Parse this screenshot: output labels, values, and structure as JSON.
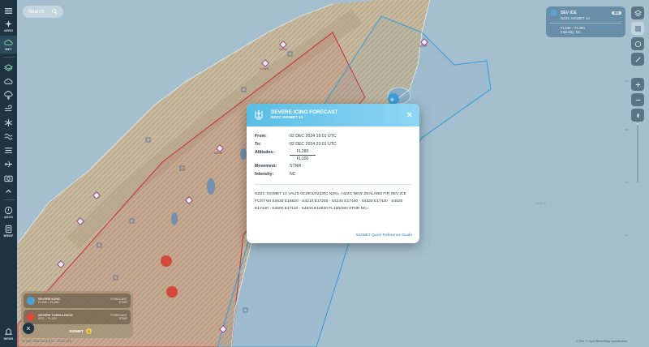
{
  "search": {
    "placeholder": "Search"
  },
  "rail": {
    "items": [
      {
        "icon": "menu-icon",
        "label": ""
      },
      {
        "icon": "aero-icon",
        "label": "AERO"
      },
      {
        "icon": "met-icon",
        "label": "MET"
      },
      {
        "icon": "layers-icon",
        "label": ""
      },
      {
        "icon": "cloud-icon",
        "label": ""
      },
      {
        "icon": "storm-icon",
        "label": ""
      },
      {
        "icon": "wind-icon",
        "label": ""
      },
      {
        "icon": "ice-icon",
        "label": ""
      },
      {
        "icon": "turbulence-icon",
        "label": ""
      },
      {
        "icon": "fog-icon",
        "label": ""
      },
      {
        "icon": "plane-icon",
        "label": ""
      },
      {
        "icon": "camera-icon",
        "label": ""
      },
      {
        "icon": "chevron-up-icon",
        "label": ""
      },
      {
        "icon": "advs-icon",
        "label": "ADVS"
      },
      {
        "icon": "brief-icon",
        "label": "BRIEF"
      }
    ],
    "bottom": {
      "icon": "notifications-icon",
      "label": "NEWS"
    }
  },
  "sig_panel": {
    "title": "SEV ICE",
    "badge": "SIG",
    "line1": "NZZC SIGMET 14",
    "line2": "FL100 – FL280",
    "line3": "Intensity: NC"
  },
  "legend": {
    "items": [
      {
        "name": "SEVERE ICING",
        "range": "FL100 – FL280",
        "type": "FORECAST",
        "movement": "STNR",
        "color": "#4aa3d8"
      },
      {
        "name": "SEVERE TURBULENCE",
        "range": "SFC – FL120",
        "type": "FORECAST",
        "movement": "STNR",
        "color": "#d84a3a"
      }
    ],
    "footer": "SIGMET",
    "footer_count": "2"
  },
  "modal": {
    "title": "SEVERE ICING FORECAST",
    "subtitle": "NZZC SIGMET 14",
    "fields": {
      "from_label": "From:",
      "from": "02 DEC 2024 19:01 UTC",
      "to_label": "To:",
      "to": "02 DEC 2024 23:01 UTC",
      "alt_label": "Altitudes:",
      "alt_top": "FL280",
      "alt_bottom": "FL100",
      "mov_label": "Movement:",
      "movement": "STNR",
      "int_label": "Intensity:",
      "intensity": "NC"
    },
    "raw": "NZZC SIGMET 14 VALID 021901/022301 NZKL- NZZC NEW ZEALAND FIR SEV ICE FCST WI S4630 E16820 - S4210 E17250 - S4240 E17440 - S4320 E17420 - S4530 E17140 - S4600 E17110 - S4630 E16820 FL100/280 STNR NC=",
    "link": "SIGMET Quick Reference Guide"
  },
  "map_labels": [
    "NZNS",
    "NZWS",
    "NZHK",
    "NZWF"
  ],
  "attribution": "© Esri © OpenStreetMap contributors",
  "timebar": "02 DEC 2024 19:01 UTC – 23:01 UTC"
}
